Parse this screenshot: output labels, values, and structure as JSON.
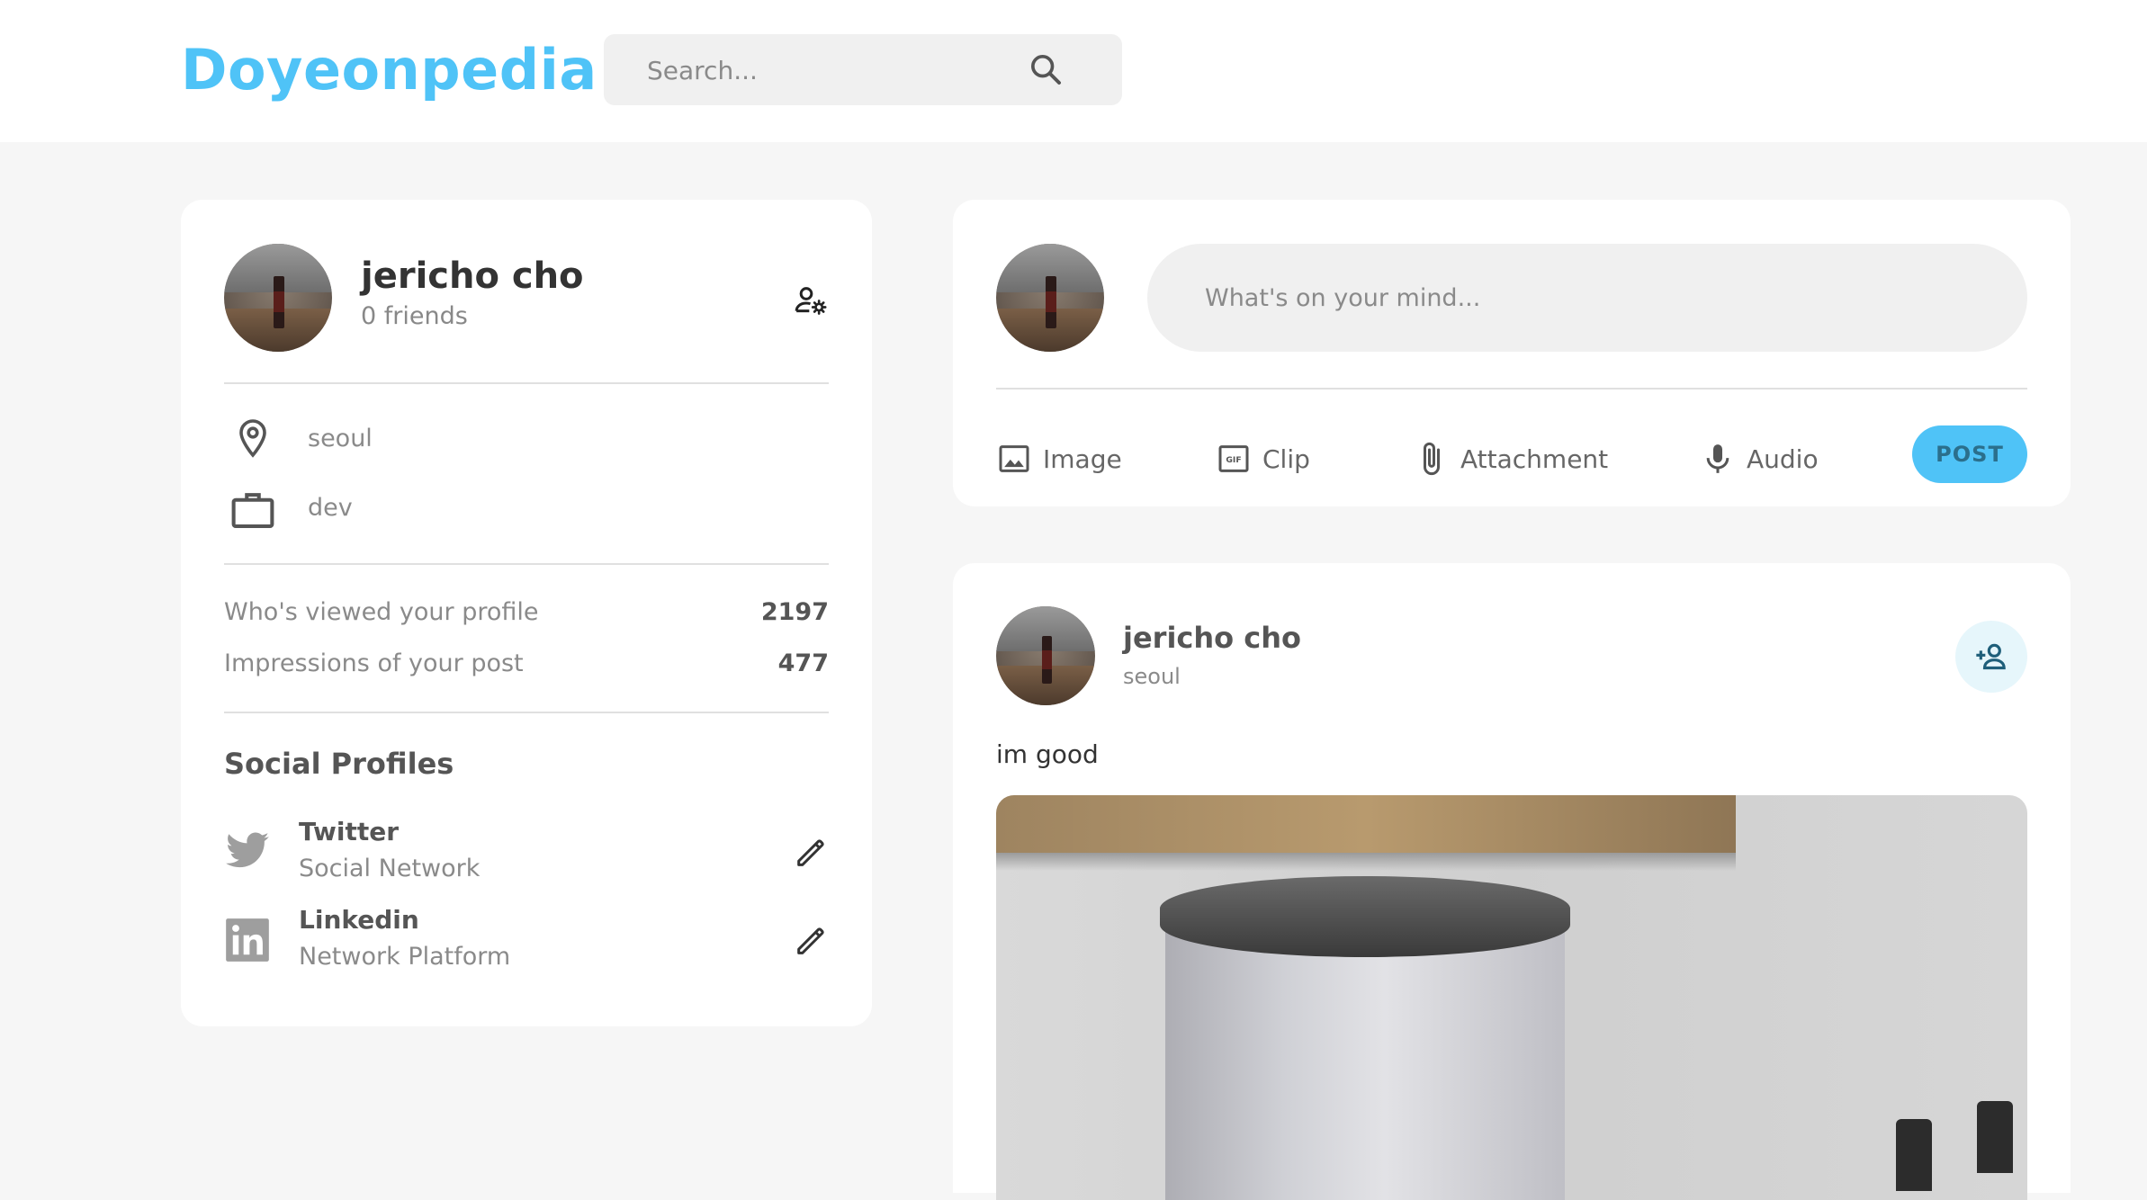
{
  "app": {
    "logo": "Doyeonpedia"
  },
  "search": {
    "placeholder": "Search..."
  },
  "profile": {
    "name": "jericho cho",
    "friends": "0 friends",
    "location": "seoul",
    "occupation": "dev",
    "stats": [
      {
        "label": "Who's viewed your profile",
        "value": "2197"
      },
      {
        "label": "Impressions of your post",
        "value": "477"
      }
    ],
    "social_title": "Social Profiles",
    "social": [
      {
        "name": "Twitter",
        "sub": "Social Network",
        "icon": "twitter-icon"
      },
      {
        "name": "Linkedin",
        "sub": "Network Platform",
        "icon": "linkedin-icon"
      }
    ]
  },
  "composer": {
    "placeholder": "What's on your mind...",
    "actions": [
      {
        "label": "Image",
        "icon": "image-icon"
      },
      {
        "label": "Clip",
        "icon": "gif-icon"
      },
      {
        "label": "Attachment",
        "icon": "paperclip-icon"
      },
      {
        "label": "Audio",
        "icon": "microphone-icon"
      }
    ],
    "post_label": "POST"
  },
  "post": {
    "author": "jericho cho",
    "location": "seoul",
    "text": "im good"
  },
  "colors": {
    "accent": "#4fc3f7",
    "background": "#f6f6f6",
    "card": "#ffffff"
  }
}
